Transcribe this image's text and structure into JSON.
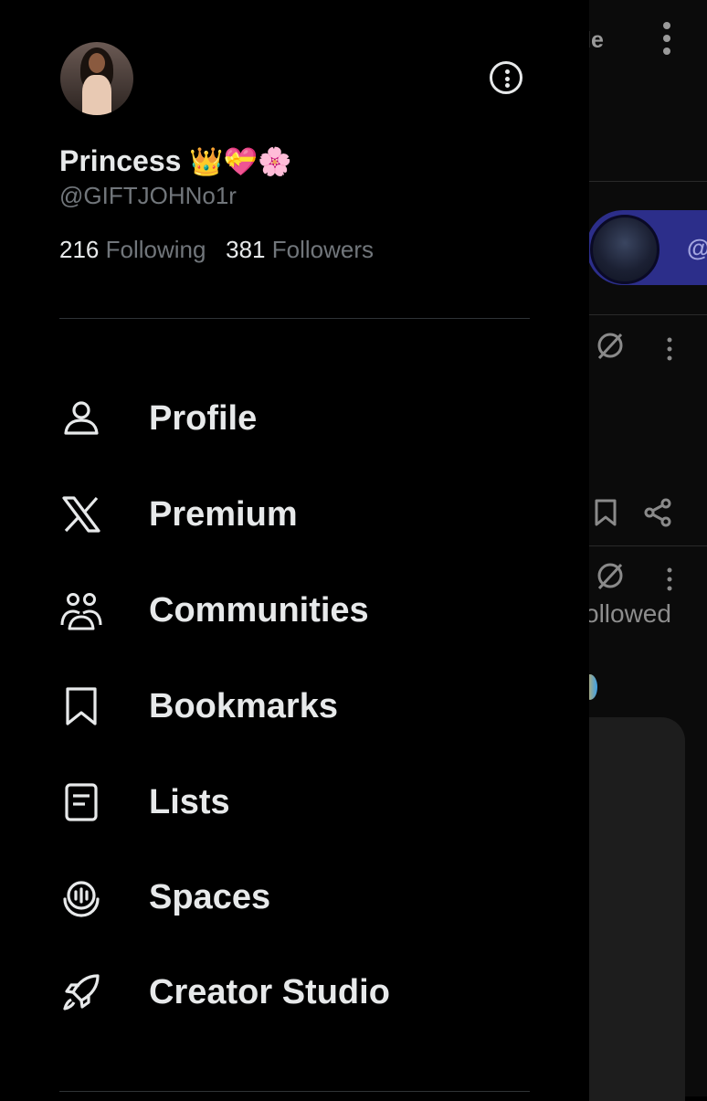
{
  "background": {
    "title_fragment": "le",
    "banner_text": "@",
    "followed_fragment": "ollowed"
  },
  "profile": {
    "name": "Princess",
    "name_emojis": "👑💝🌸",
    "handle": "@GIFTJOHNo1r",
    "following_count": "216",
    "following_label": "Following",
    "followers_count": "381",
    "followers_label": "Followers"
  },
  "menu": {
    "items": [
      {
        "label": "Profile",
        "icon": "person-icon"
      },
      {
        "label": "Premium",
        "icon": "x-logo-icon"
      },
      {
        "label": "Communities",
        "icon": "communities-icon"
      },
      {
        "label": "Bookmarks",
        "icon": "bookmark-icon"
      },
      {
        "label": "Lists",
        "icon": "list-icon"
      },
      {
        "label": "Spaces",
        "icon": "spaces-icon"
      },
      {
        "label": "Creator Studio",
        "icon": "rocket-icon"
      }
    ]
  },
  "colors": {
    "background": "#000000",
    "primary_text": "#e7e9ea",
    "secondary_text": "#71767b",
    "divider": "#2f3336",
    "banner": "#2c2e8a"
  }
}
